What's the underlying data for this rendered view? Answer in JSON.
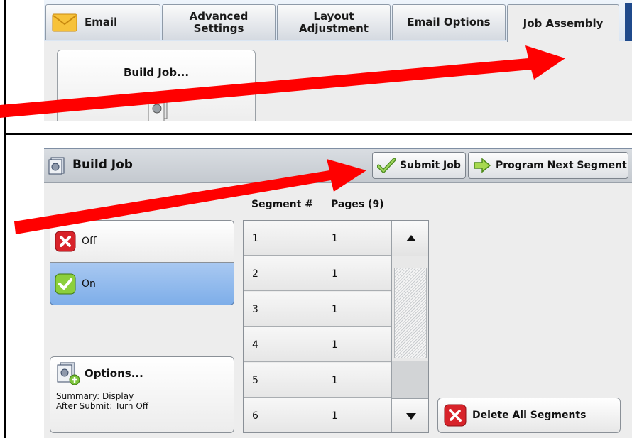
{
  "tabs": [
    {
      "label": "Email"
    },
    {
      "label": "Advanced Settings"
    },
    {
      "label": "Layout Adjustment"
    },
    {
      "label": "Email Options"
    },
    {
      "label": "Job Assembly"
    }
  ],
  "job_assembly": {
    "build_job_button_label": "Build Job..."
  },
  "build_job_screen": {
    "title": "Build Job",
    "submit_label": "Submit Job",
    "next_segment_label": "Program Next Segment",
    "off_label": "Off",
    "on_label": "On",
    "selected": "On",
    "columns": {
      "segment": "Segment #",
      "pages": "Pages (9)"
    },
    "segments": [
      {
        "num": "1",
        "pages": "1"
      },
      {
        "num": "2",
        "pages": "1"
      },
      {
        "num": "3",
        "pages": "1"
      },
      {
        "num": "4",
        "pages": "1"
      },
      {
        "num": "5",
        "pages": "1"
      },
      {
        "num": "6",
        "pages": "1"
      }
    ],
    "options_label": "Options...",
    "summary_line1": "Summary: Display",
    "summary_line2": "After Submit: Turn Off",
    "delete_label": "Delete All Segments"
  },
  "colors": {
    "active_on_bg": "#8fb8ee",
    "arrow": "#ff0000",
    "tab_edge": "#1f4a8c"
  },
  "icons": {
    "email": "envelope-icon",
    "build_job": "build-job-icon",
    "submit": "checkmark-icon",
    "next": "right-arrow-icon",
    "off": "red-x-icon",
    "on": "green-check-icon",
    "options": "options-icon",
    "delete": "delete-segments-icon",
    "scroll_up": "triangle-up-icon",
    "scroll_down": "triangle-down-icon"
  }
}
